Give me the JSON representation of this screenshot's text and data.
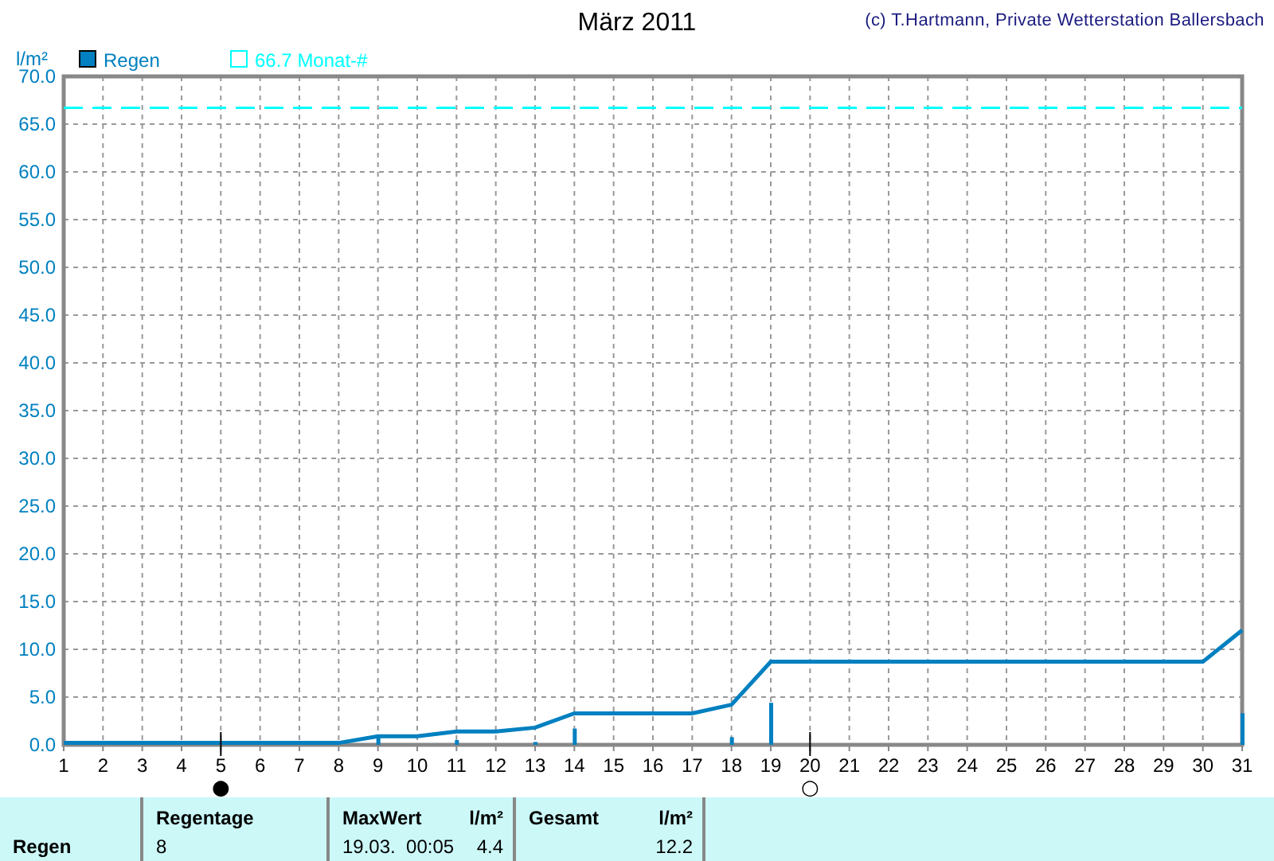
{
  "header": {
    "title": "März 2011",
    "copyright": "(c) T.Hartmann, Private Wetterstation Ballersbach"
  },
  "chart": {
    "chart_data": {
      "type": "line",
      "ylabel": "l/m²",
      "x": [
        1,
        2,
        3,
        4,
        5,
        6,
        7,
        8,
        9,
        10,
        11,
        12,
        13,
        14,
        15,
        16,
        17,
        18,
        19,
        20,
        21,
        22,
        23,
        24,
        25,
        26,
        27,
        28,
        29,
        30,
        31
      ],
      "series": [
        {
          "name": "Regen",
          "color": "#0080c0",
          "line_style": "solid",
          "values": [
            0.2,
            0.2,
            0.2,
            0.2,
            0.2,
            0.2,
            0.2,
            0.2,
            0.9,
            0.9,
            1.4,
            1.4,
            1.8,
            3.3,
            3.3,
            3.3,
            3.3,
            4.2,
            8.7,
            8.7,
            8.7,
            8.7,
            8.7,
            8.7,
            8.7,
            8.7,
            8.7,
            8.7,
            8.7,
            8.7,
            12.0
          ]
        },
        {
          "name": "66.7 Monat-#",
          "color": "#00ffff",
          "line_style": "dashed",
          "values": [
            66.7,
            66.7,
            66.7,
            66.7,
            66.7,
            66.7,
            66.7,
            66.7,
            66.7,
            66.7,
            66.7,
            66.7,
            66.7,
            66.7,
            66.7,
            66.7,
            66.7,
            66.7,
            66.7,
            66.7,
            66.7,
            66.7,
            66.7,
            66.7,
            66.7,
            66.7,
            66.7,
            66.7,
            66.7,
            66.7,
            66.7
          ]
        },
        {
          "type": "bar",
          "color": "#0080c0",
          "values": [
            null,
            null,
            null,
            null,
            null,
            null,
            null,
            null,
            0.8,
            null,
            0.5,
            null,
            0.3,
            1.7,
            null,
            null,
            null,
            0.8,
            4.4,
            null,
            null,
            null,
            null,
            null,
            null,
            null,
            null,
            null,
            null,
            null,
            3.3
          ]
        }
      ],
      "grid": true,
      "legend": "top-left",
      "xlim": [
        1,
        31
      ],
      "ylim": [
        0,
        70
      ],
      "xticks": [
        1,
        2,
        3,
        4,
        5,
        6,
        7,
        8,
        9,
        10,
        11,
        12,
        13,
        14,
        15,
        16,
        17,
        18,
        19,
        20,
        21,
        22,
        23,
        24,
        25,
        26,
        27,
        28,
        29,
        30,
        31
      ],
      "yticks": [
        {
          "value": 0,
          "label": "0.0"
        },
        {
          "value": 5,
          "label": "5.0"
        },
        {
          "value": 10,
          "label": "10.0"
        },
        {
          "value": 15,
          "label": "15.0"
        },
        {
          "value": 20,
          "label": "20.0"
        },
        {
          "value": 25,
          "label": "25.0"
        },
        {
          "value": 30,
          "label": "30.0"
        },
        {
          "value": 35,
          "label": "35.0"
        },
        {
          "value": 40,
          "label": "40.0"
        },
        {
          "value": 45,
          "label": "45.0"
        },
        {
          "value": 50,
          "label": "50.0"
        },
        {
          "value": 55,
          "label": "55.0"
        },
        {
          "value": 60,
          "label": "60.0"
        },
        {
          "value": 65,
          "label": "65.0"
        },
        {
          "value": 70,
          "label": "70.0"
        }
      ],
      "annotations": [
        {
          "x": 5,
          "text": "●"
        },
        {
          "x": 20,
          "text": "○"
        }
      ]
    }
  },
  "summary": {
    "row_label": "Regen",
    "columns": [
      {
        "heading": "Regentage",
        "value": "8"
      },
      {
        "heading": "MaxWert",
        "unit": "l/m²",
        "time": "19.03.  00:05",
        "value": "4.4"
      },
      {
        "heading": "Gesamt",
        "unit": "l/m²",
        "value": "12.2"
      }
    ]
  }
}
